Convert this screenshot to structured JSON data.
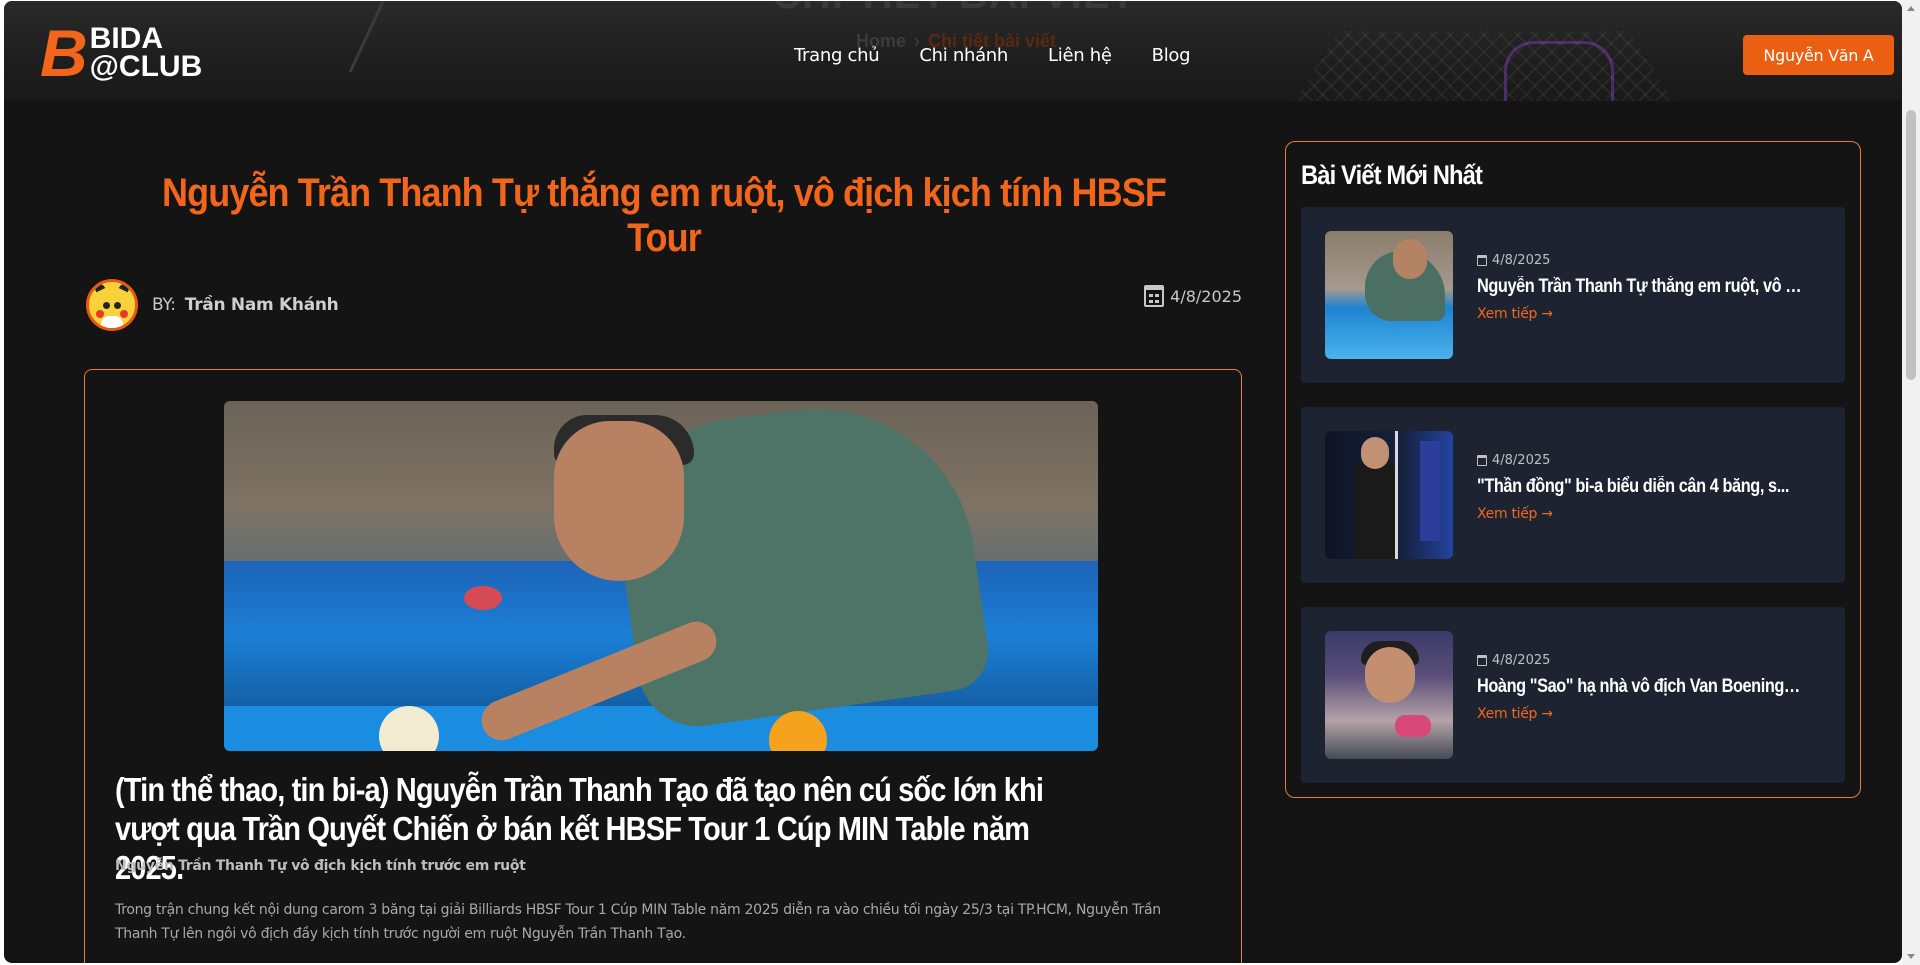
{
  "hero": {
    "title": "CHI TIẾT BÀI VIẾT",
    "breadcrumb_home": "Home",
    "breadcrumb_sep": "›",
    "breadcrumb_current": "Chi tiết bài viết"
  },
  "logo": {
    "mark": "B",
    "line1": "BIDA",
    "line2": "@CLUB"
  },
  "nav": {
    "items": [
      {
        "label": "Trang chủ"
      },
      {
        "label": "Chi nhánh"
      },
      {
        "label": "Liên hệ"
      },
      {
        "label": "Blog"
      }
    ]
  },
  "user": {
    "name": "Nguyễn Văn A"
  },
  "article": {
    "title": "Nguyễn Trần Thanh Tự thắng em ruột, vô địch kịch tính HBSF Tour",
    "by_label": "BY:",
    "author": "Trần Nam Khánh",
    "date": "4/8/2025",
    "lead_heading": "(Tin thể thao, tin bi-a) Nguyễn Trần Thanh Tạo đã tạo nên cú sốc lớn khi vượt qua Trần Quyết Chiến ở bán kết HBSF Tour 1 Cúp MIN Table năm 2025.",
    "sub_caption": "Nguyễn Trần Thanh Tự vô địch kịch tính trước em ruột",
    "body": "Trong trận chung kết nội dung carom 3 băng tại giải Billiards HBSF Tour 1 Cúp MIN Table năm 2025 diễn ra vào chiều tối ngày 25/3 tại TP.HCM, Nguyễn Trần Thanh Tự lên ngôi vô địch đầy kịch tính trước người em ruột Nguyễn Trần Thanh Tạo."
  },
  "sidebar": {
    "title": "Bài Viết Mới Nhất",
    "read_more": "Xem tiếp →",
    "posts": [
      {
        "date": "4/8/2025",
        "title": "Nguyễn Trần Thanh Tự thắng em ruột, vô đ..."
      },
      {
        "date": "4/8/2025",
        "title": "\"Thần đồng\" bi-a biểu diễn cân 4 băng, s..."
      },
      {
        "date": "4/8/2025",
        "title": "Hoàng \"Sao\" hạ nhà vô địch Van Boening, ..."
      }
    ]
  },
  "colors": {
    "accent": "#ea5f12",
    "title_orange": "#f2661c",
    "background": "#141414",
    "card": "#1e2331"
  }
}
